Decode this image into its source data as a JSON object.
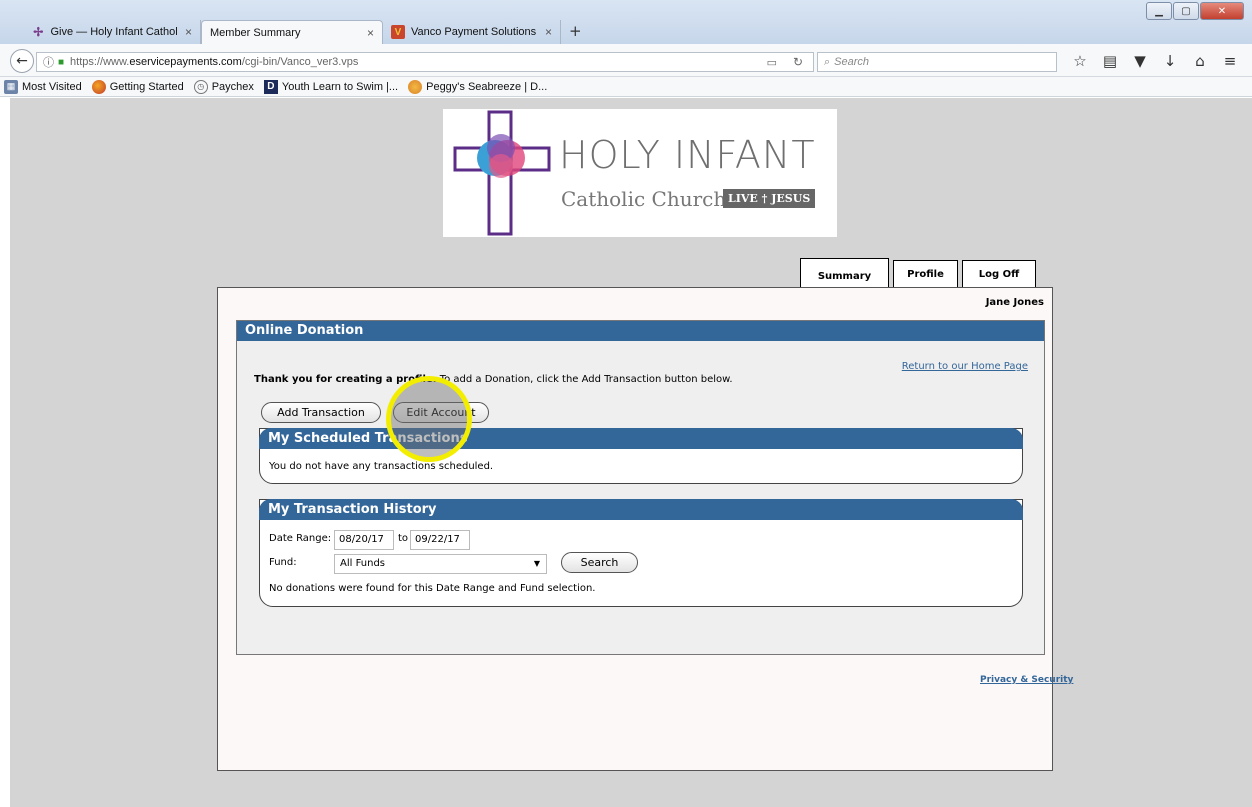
{
  "browser": {
    "tabs": [
      {
        "title": "Give — Holy Infant Catholic (",
        "active": false
      },
      {
        "title": "Member Summary",
        "active": true
      },
      {
        "title": "Vanco Payment Solutions",
        "active": false
      }
    ],
    "url_prefix": "https://www.",
    "url_domain": "eservicepayments.com",
    "url_path": "/cgi-bin/Vanco_ver3.vps",
    "search_placeholder": "Search",
    "bookmarks": [
      {
        "label": "Most Visited",
        "icon": "most-visited-icon"
      },
      {
        "label": "Getting Started",
        "icon": "firefox-icon"
      },
      {
        "label": "Paychex",
        "icon": "paychex-icon"
      },
      {
        "label": "Youth Learn to Swim |...",
        "icon": "d-logo-icon"
      },
      {
        "label": "Peggy's Seabreeze | D...",
        "icon": "seabreeze-icon"
      }
    ],
    "toolbar_icons": [
      "star-icon",
      "reading-list-icon",
      "pocket-icon",
      "download-icon",
      "home-icon",
      "menu-icon"
    ]
  },
  "logo": {
    "name": "HOLY INFANT",
    "subtitle": "Catholic Church",
    "badge": "LIVE † JESUS"
  },
  "nav_tabs": [
    "Summary",
    "Profile",
    "Log Off"
  ],
  "user": {
    "name": "Jane Jones"
  },
  "donation": {
    "title": "Online Donation",
    "home_link": "Return to our Home Page",
    "thanks_bold": "Thank you for creating a profile.",
    "thanks_rest": " To add a Donation, click the Add Transaction button below.",
    "add_button": "Add Transaction",
    "edit_button": "Edit Account"
  },
  "scheduled": {
    "title": "My Scheduled Transactions",
    "empty_text": "You do not have any transactions scheduled."
  },
  "history": {
    "title": "My Transaction History",
    "date_range_label": "Date Range:",
    "date_from": "08/20/17",
    "to_label": "to",
    "date_to": "09/22/17",
    "fund_label": "Fund:",
    "fund_value": "All Funds",
    "search_button": "Search",
    "empty_text": "No donations were found for this Date Range and Fund selection."
  },
  "footer": {
    "privacy_link": "Privacy & Security"
  },
  "colors": {
    "header_blue": "#336699",
    "highlight_yellow": "#f3ee00"
  }
}
